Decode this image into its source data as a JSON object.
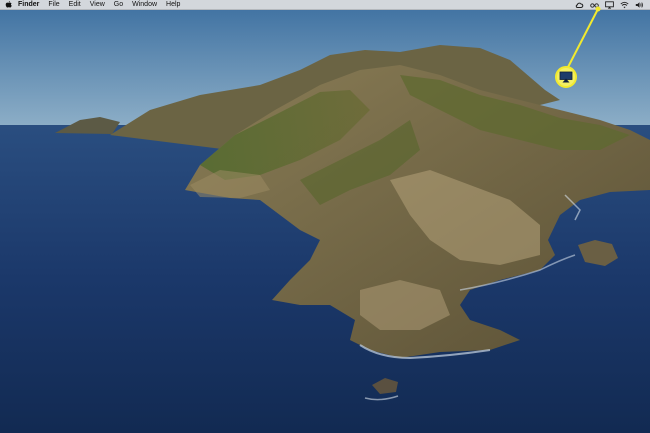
{
  "menubar": {
    "apple_icon": "apple-icon",
    "app_name": "Finder",
    "items": [
      "File",
      "Edit",
      "View",
      "Go",
      "Window",
      "Help"
    ]
  },
  "status_icons": [
    "creative-cloud-icon",
    "glasses-icon",
    "airplay-icon",
    "wifi-icon",
    "volume-icon"
  ],
  "callout": {
    "target": "airplay-icon",
    "color": "#f2ea2e"
  },
  "colors": {
    "menubar": "#d3d7dc",
    "sky": "#5e89b2",
    "ocean": "#16315d"
  }
}
